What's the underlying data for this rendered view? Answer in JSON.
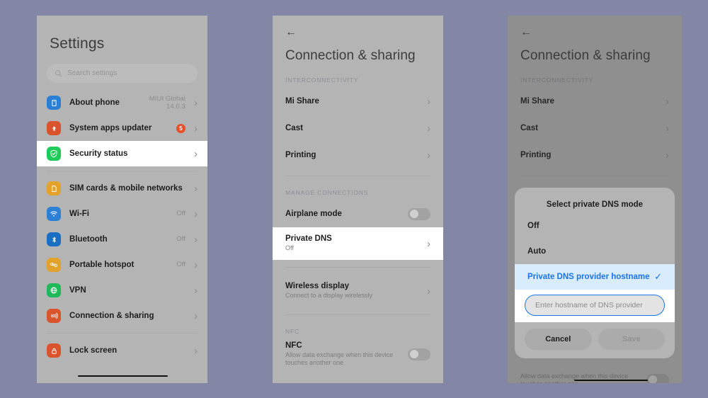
{
  "meta": {
    "background_color": "#8486a6",
    "panel_color": "#b4b4b4",
    "accent_blue": "#1a73e8",
    "highlight_white": "#ffffff"
  },
  "phone1": {
    "title": "Settings",
    "search": {
      "placeholder": "Search settings",
      "value": ""
    },
    "group1": [
      {
        "label": "About phone",
        "value": "MIUI Global\n14.0.3",
        "icon": "phone-icon",
        "icon_color": "#2b7fd4",
        "chevron": "›",
        "highlighted": false
      },
      {
        "label": "System apps updater",
        "value": "",
        "badge": "5",
        "icon": "up-arrow-icon",
        "icon_color": "#d9542c",
        "chevron": "›",
        "highlighted": false
      },
      {
        "label": "Security status",
        "value": "",
        "icon": "shield-check-icon",
        "icon_color": "#1fcb5a",
        "chevron": "›",
        "highlighted": true
      }
    ],
    "group2": [
      {
        "label": "SIM cards & mobile networks",
        "value": "",
        "icon": "sim-card-icon",
        "icon_color": "#e2a22c",
        "chevron": "›"
      },
      {
        "label": "Wi-Fi",
        "value": "Off",
        "icon": "wifi-icon",
        "icon_color": "#2b7fd4",
        "chevron": "›"
      },
      {
        "label": "Bluetooth",
        "value": "Off",
        "icon": "bluetooth-icon",
        "icon_color": "#1a6fc4",
        "chevron": "›"
      },
      {
        "label": "Portable hotspot",
        "value": "Off",
        "icon": "hotspot-icon",
        "icon_color": "#e2a22c",
        "chevron": "›"
      },
      {
        "label": "VPN",
        "value": "",
        "icon": "globe-icon",
        "icon_color": "#1fb85a",
        "chevron": "›"
      },
      {
        "label": "Connection & sharing",
        "value": "",
        "icon": "connection-sharing-icon",
        "icon_color": "#d9542c",
        "chevron": "›"
      }
    ],
    "group3": [
      {
        "label": "Lock screen",
        "value": "",
        "icon": "lock-icon",
        "icon_color": "#d9542c",
        "chevron": "›"
      }
    ]
  },
  "phone2": {
    "back": "←",
    "title": "Connection & sharing",
    "section1": {
      "header": "INTERCONNECTIVITY",
      "items": [
        {
          "label": "Mi Share",
          "sub": "",
          "chevron": "›"
        },
        {
          "label": "Cast",
          "sub": "",
          "chevron": "›"
        },
        {
          "label": "Printing",
          "sub": "",
          "chevron": "›"
        }
      ]
    },
    "section2": {
      "header": "MANAGE CONNECTIONS",
      "airplane": {
        "label": "Airplane mode",
        "toggle": "off"
      },
      "private_dns": {
        "label": "Private DNS",
        "sub": "Off",
        "chevron": "›",
        "highlighted": true
      },
      "wireless_display": {
        "label": "Wireless display",
        "sub": "Connect to a display wirelessly",
        "chevron": "›"
      }
    },
    "section3": {
      "header": "NFC",
      "nfc": {
        "label": "NFC",
        "sub": "Allow data exchange when this device touches another one",
        "toggle": "off"
      }
    }
  },
  "phone3": {
    "back": "←",
    "title": "Connection & sharing",
    "section1": {
      "header": "INTERCONNECTIVITY",
      "items": [
        {
          "label": "Mi Share",
          "chevron": "›"
        },
        {
          "label": "Cast",
          "chevron": "›"
        },
        {
          "label": "Printing",
          "chevron": "›"
        }
      ]
    },
    "background_nfc": {
      "sub": "Allow data exchange when this device touches another one"
    },
    "dialog": {
      "title": "Select private DNS mode",
      "options": [
        {
          "label": "Off",
          "selected": false
        },
        {
          "label": "Auto",
          "selected": false
        },
        {
          "label": "Private DNS provider hostname",
          "selected": true,
          "tick": "✓"
        }
      ],
      "input": {
        "placeholder": "Enter hostname of DNS provider",
        "value": ""
      },
      "cancel_label": "Cancel",
      "save_label": "Save"
    }
  }
}
